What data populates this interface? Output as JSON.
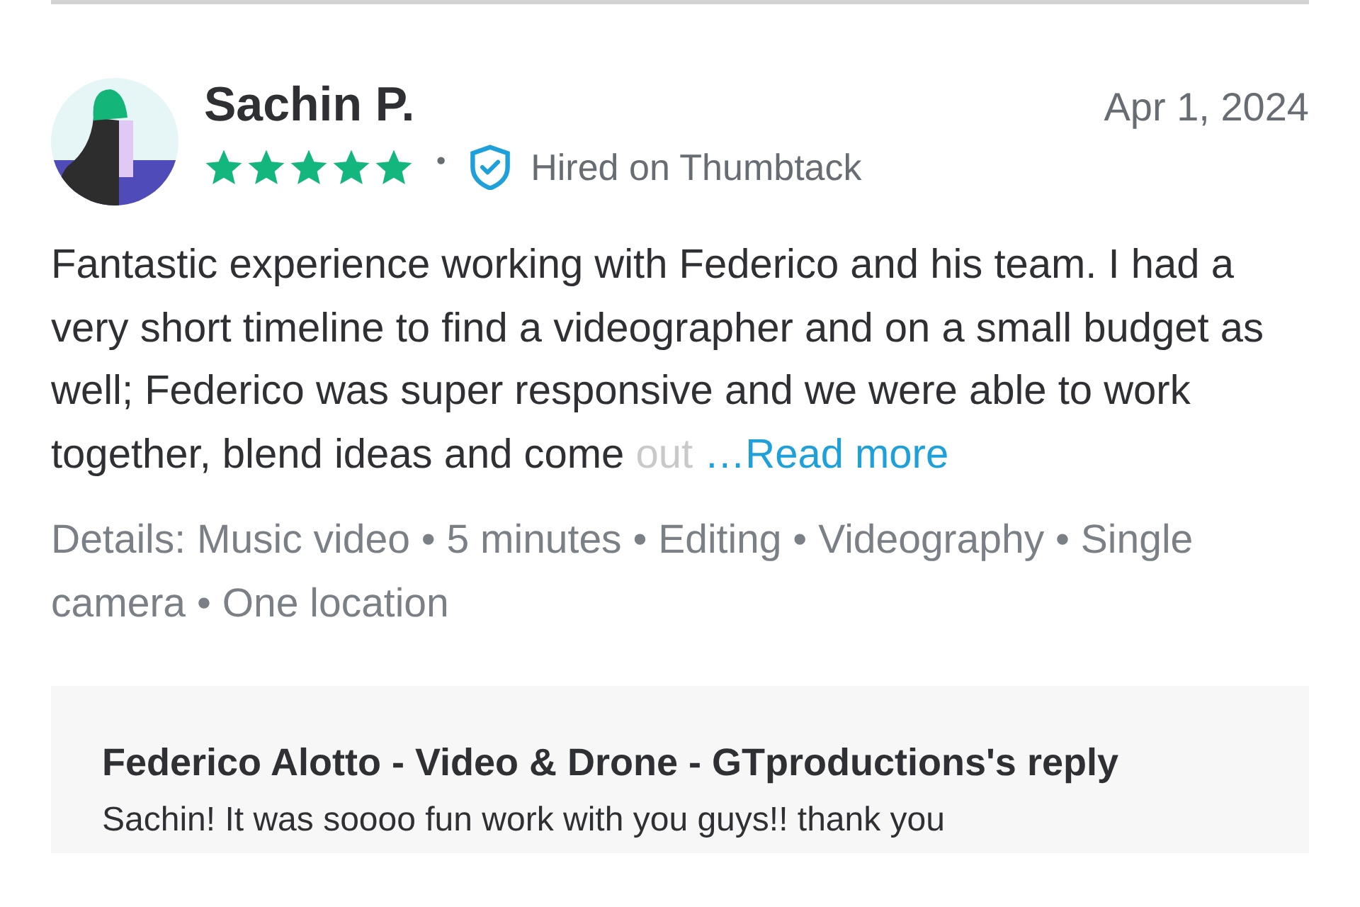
{
  "review": {
    "reviewer": "Sachin P.",
    "date": "Apr 1, 2024",
    "stars": 5,
    "separator": "•",
    "hired_label": "Hired on Thumbtack",
    "body": "Fantastic experience working with Federico and his team. I had a very short timeline to find a videographer and on a small budget as well; Federico was super responsive and we were able to work together, blend ideas and come",
    "body_faded": "out",
    "read_more": "…Read more",
    "details": "Details: Music video • 5 minutes • Editing • Videography • Single camera • One location"
  },
  "reply": {
    "title": "Federico Alotto - Video & Drone - GTproductions's reply",
    "text": "Sachin! It was soooo fun work with you guys!! thank you"
  }
}
